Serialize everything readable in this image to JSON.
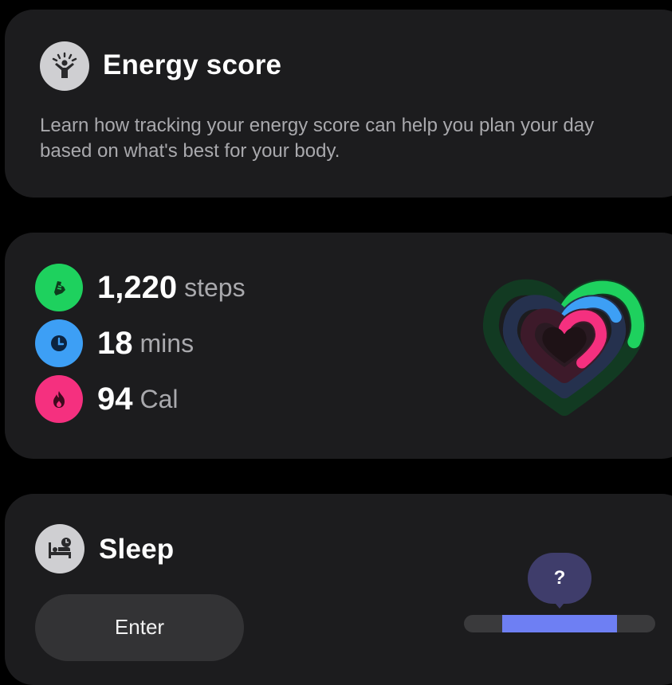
{
  "energy_card": {
    "title": "Energy score",
    "description": "Learn how tracking your energy score can help you plan your day based on what's best for your body.",
    "icon": "person-sunrise-icon"
  },
  "activity_card": {
    "stats": [
      {
        "value": "1,220",
        "unit": "steps",
        "icon": "shoe-icon",
        "color": "#1ed15e"
      },
      {
        "value": "18",
        "unit": "mins",
        "icon": "clock-icon",
        "color": "#3d9ff5"
      },
      {
        "value": "94",
        "unit": "Cal",
        "icon": "flame-icon",
        "color": "#f5307f"
      }
    ],
    "rings": {
      "steps_progress": 0.28,
      "mins_progress": 0.2,
      "cal_progress": 0.4
    }
  },
  "sleep_card": {
    "title": "Sleep",
    "icon": "bed-icon",
    "enter_label": "Enter",
    "help_label": "?",
    "bar": {
      "start": 0.2,
      "end": 0.8
    }
  },
  "colors": {
    "background": "#000000",
    "card": "#1c1c1e",
    "steps": "#1ed15e",
    "mins": "#3d9ff5",
    "cal": "#f5307f",
    "sleep_bar": "#6e7ff3",
    "help_bubble": "#3f3d6b"
  }
}
